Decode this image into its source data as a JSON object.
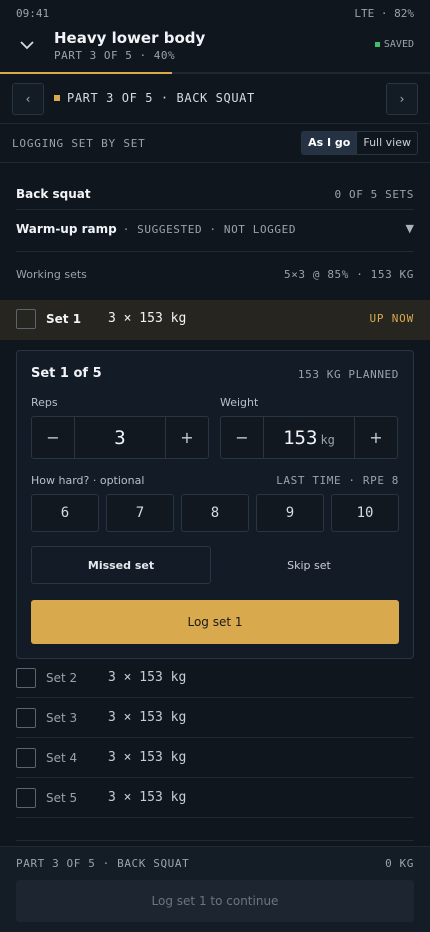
{
  "status_bar": {
    "time": "09:41",
    "network": "LTE · 82%"
  },
  "header": {
    "title": "Heavy lower body",
    "subtitle": "PART 3 OF 5 · 40%",
    "saved": "SAVED",
    "progress": 0.4
  },
  "part_nav": {
    "prev": "‹",
    "next": "›",
    "label": "PART 3 OF 5 · BACK SQUAT"
  },
  "mode": {
    "label": "LOGGING SET BY SET",
    "options": [
      "As I go",
      "Full view"
    ],
    "selected": "As I go"
  },
  "exercise": {
    "name": "Back squat",
    "progress": "0 OF 5 SETS",
    "warmup_name": "Warm-up ramp",
    "warmup_meta": "· SUGGESTED · NOT LOGGED",
    "working_label": "Working sets",
    "working_meta": "5×3 @ 85% · 153 KG"
  },
  "current_set": {
    "name": "Set 1",
    "value": "3 × 153 kg",
    "badge": "UP NOW"
  },
  "card": {
    "title": "Set 1 of 5",
    "planned": "153 KG PLANNED",
    "reps_label": "Reps",
    "reps_value": "3",
    "weight_label": "Weight",
    "weight_value": "153",
    "weight_unit": "kg",
    "minus": "−",
    "plus": "+",
    "rpe_label": "How hard? · optional",
    "rpe_last": "LAST TIME · RPE 8",
    "rpe_options": [
      "6",
      "7",
      "8",
      "9",
      "10"
    ],
    "missed": "Missed set",
    "skip": "Skip set",
    "log": "Log set 1"
  },
  "sets": [
    {
      "name": "Set 2",
      "value": "3 × 153 kg"
    },
    {
      "name": "Set 3",
      "value": "3 × 153 kg"
    },
    {
      "name": "Set 4",
      "value": "3 × 153 kg"
    },
    {
      "name": "Set 5",
      "value": "3 × 153 kg"
    }
  ],
  "footer": {
    "label": "PART 3 OF 5 · BACK SQUAT",
    "total": "0 KG",
    "button": "Log set 1 to continue"
  },
  "colors": {
    "accent": "#d9a94e",
    "saved_dot": "#3fbf6a",
    "background": "#0f161e"
  }
}
